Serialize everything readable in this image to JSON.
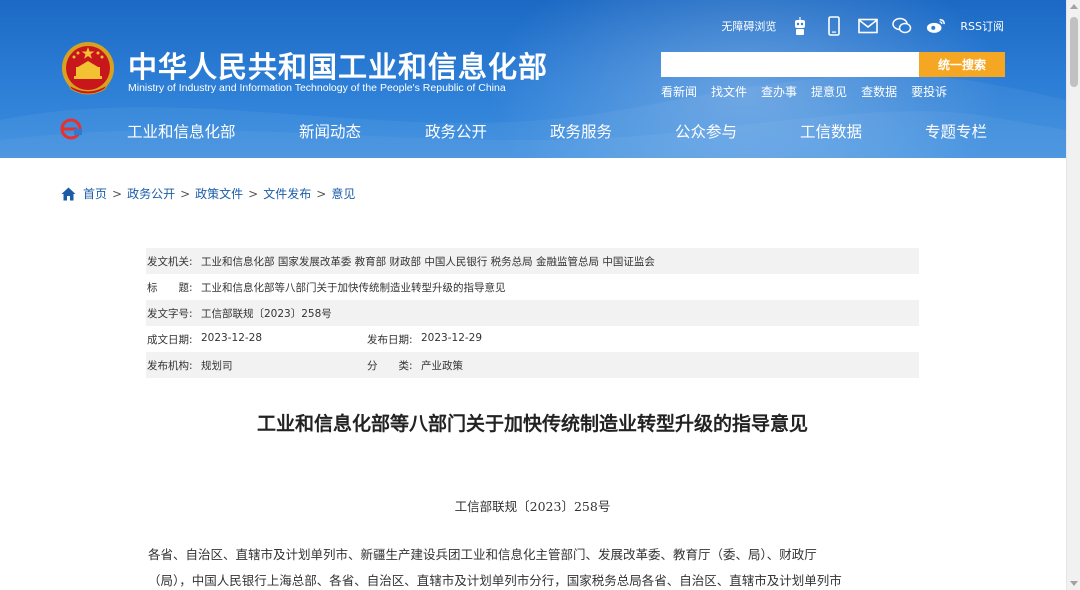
{
  "header": {
    "title_cn": "中华人民共和国工业和信息化部",
    "title_en": "Ministry of Industry and Information Technology of the People's Republic of China",
    "top_links": {
      "accessibility": "无障碍浏览",
      "rss": "RSS订阅"
    },
    "top_icons": [
      "robot-icon",
      "mobile-icon",
      "mail-icon",
      "wechat-icon",
      "weibo-icon"
    ],
    "search": {
      "placeholder": "",
      "button": "统一搜索"
    },
    "quick_links": [
      "看新闻",
      "找文件",
      "查办事",
      "提意见",
      "查数据",
      "要投诉"
    ],
    "nav": [
      "工业和信息化部",
      "新闻动态",
      "政务公开",
      "政务服务",
      "公众参与",
      "工信数据",
      "专题专栏"
    ]
  },
  "breadcrumb": [
    "首页",
    "政务公开",
    "政策文件",
    "文件发布",
    "意见"
  ],
  "meta": {
    "issuer_label": "发文机关:",
    "issuer": "工业和信息化部 国家发展改革委 教育部 财政部 中国人民银行 税务总局 金融监管总局 中国证监会",
    "title_label": "标　　题:",
    "title": "工业和信息化部等八部门关于加快传统制造业转型升级的指导意见",
    "doc_no_label": "发文字号:",
    "doc_no": "工信部联规〔2023〕258号",
    "created_label": "成文日期:",
    "created": "2023-12-28",
    "published_label": "发布日期:",
    "published": "2023-12-29",
    "org_label": "发布机构:",
    "org": "规划司",
    "category_label": "分　　类:",
    "category": "产业政策"
  },
  "document": {
    "title": "工业和信息化部等八部门关于加快传统制造业转型升级的指导意见",
    "number": "工信部联规〔2023〕258号",
    "body_lines": [
      "各省、自治区、直辖市及计划单列市、新疆生产建设兵团工业和信息化主管部门、发展改革委、教育厅（委、局）、财政厅",
      "（局），中国人民银行上海总部、各省、自治区、直辖市及计划单列市分行，国家税务总局各省、自治区、直辖市及计划单列市"
    ]
  },
  "colors": {
    "header_blue": "#2a7bd4",
    "search_orange": "#f5a623",
    "link_blue": "#1a5ca8",
    "meta_shade": "#f2f2f2"
  }
}
